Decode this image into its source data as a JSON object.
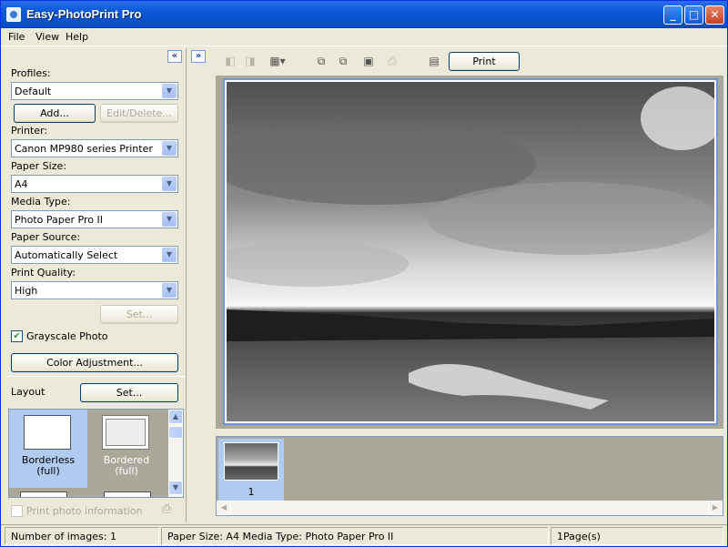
{
  "window": {
    "title": "Easy-PhotoPrint Pro",
    "min_label": "_",
    "max_label": "□",
    "close_label": "✕"
  },
  "menu": {
    "items": [
      {
        "label": "File"
      },
      {
        "label": "View"
      },
      {
        "label": "Help"
      }
    ]
  },
  "left_panel": {
    "collapse_label": "«",
    "profiles": {
      "label": "Profiles:",
      "value": "Default",
      "add_label": "Add...",
      "edit_label": "Edit/Delete..."
    },
    "printer": {
      "label": "Printer:",
      "value": "Canon MP980 series Printer"
    },
    "paper_size": {
      "label": "Paper Size:",
      "value": "A4"
    },
    "media_type": {
      "label": "Media Type:",
      "value": "Photo Paper Pro II"
    },
    "paper_source": {
      "label": "Paper Source:",
      "value": "Automatically Select"
    },
    "print_quality": {
      "label": "Print Quality:",
      "value": "High",
      "set_label": "Set..."
    },
    "grayscale": {
      "label": "Grayscale Photo",
      "checked": true
    },
    "color_adjust_label": "Color Adjustment...",
    "layout": {
      "label": "Layout",
      "set_label": "Set...",
      "items": [
        {
          "line1": "Borderless",
          "line2": "(full)"
        },
        {
          "line1": "Bordered",
          "line2": "(full)"
        }
      ]
    },
    "print_info": {
      "label": "Print photo information",
      "checked": false
    }
  },
  "divider": {
    "expand_label": "»"
  },
  "toolbar": {
    "print_label": "Print"
  },
  "thumbnails": [
    {
      "label": "1"
    }
  ],
  "status": {
    "images": "Number of images: 1",
    "paper": "Paper Size: A4  Media Type: Photo Paper Pro II",
    "pages": "1Page(s)"
  },
  "colors": {
    "titlebar": "#0a58d6",
    "selection": "#b1cbf0",
    "frame": "#6d98d8"
  }
}
